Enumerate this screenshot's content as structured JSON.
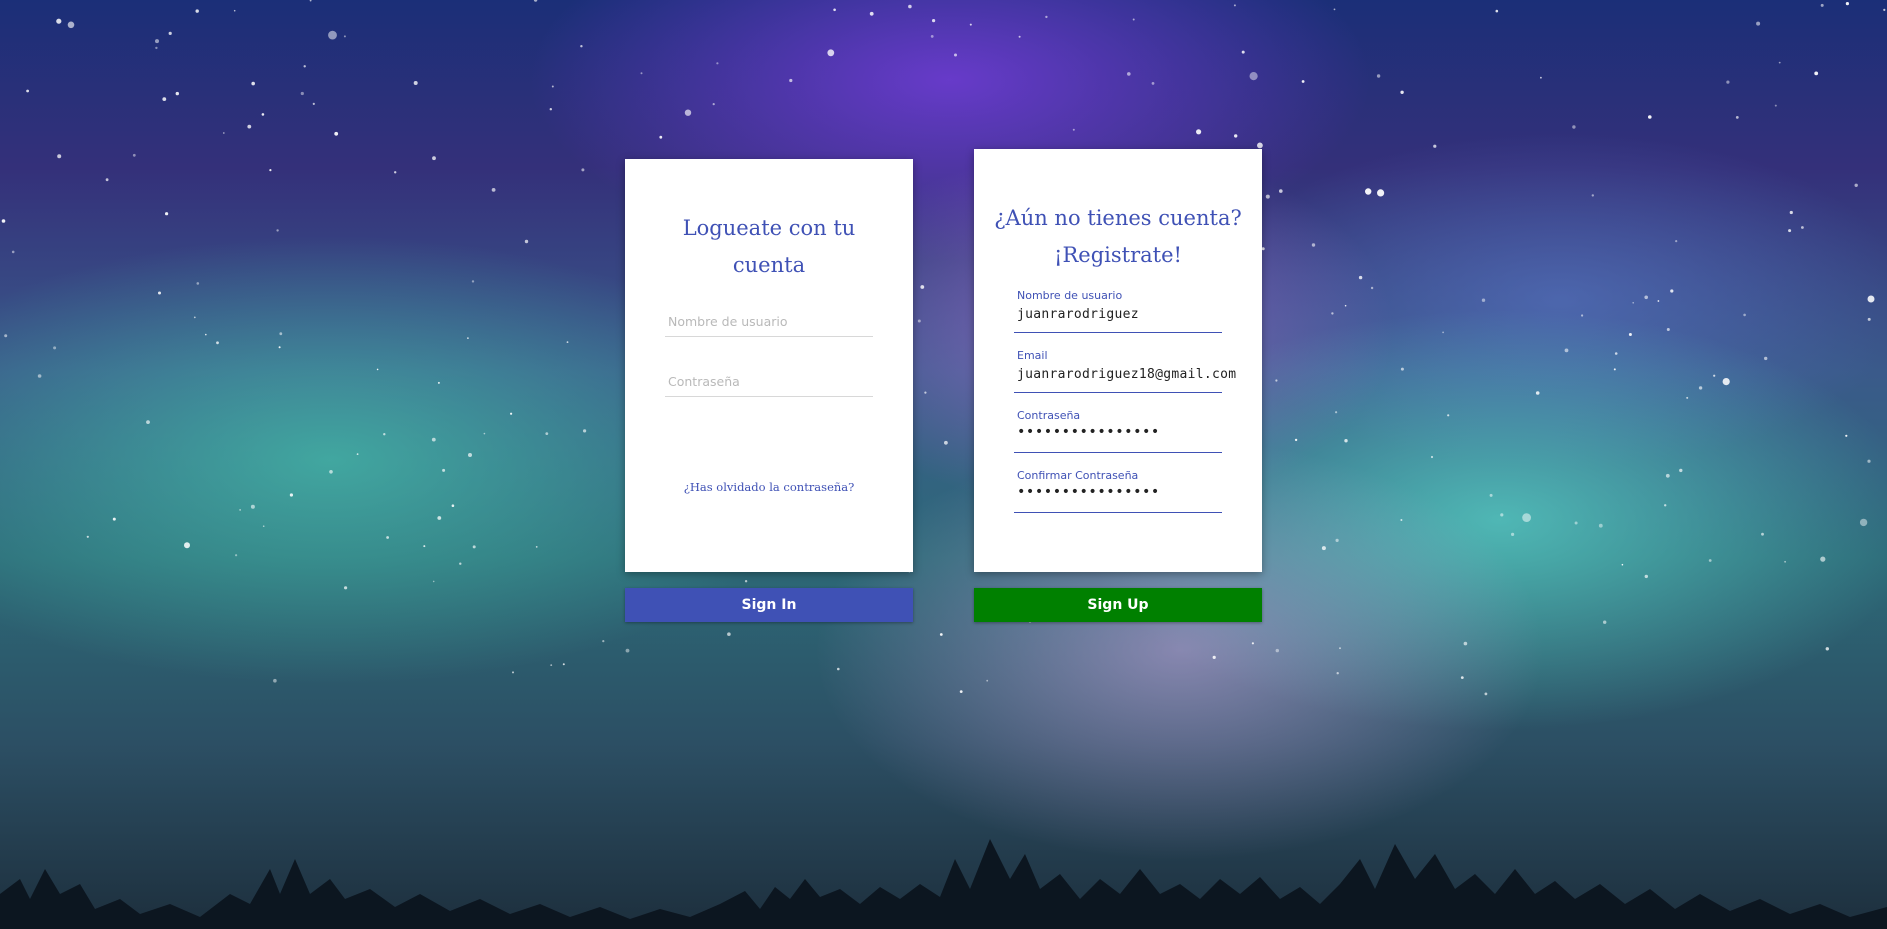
{
  "login": {
    "title": "Logueate con tu cuenta",
    "username_placeholder": "Nombre de usuario",
    "password_placeholder": "Contraseña",
    "forgot_link": "¿Has olvidado la contraseña?",
    "submit_label": "Sign In"
  },
  "register": {
    "title_line1": "¿Aún no tienes cuenta?",
    "title_line2": "¡Registrate!",
    "fields": [
      {
        "label": "Nombre de usuario",
        "value": "juanrarodriguez"
      },
      {
        "label": "Email",
        "value": "juanrarodriguez18@gmail.com"
      },
      {
        "label": "Contraseña",
        "value": "••••••••••••••••"
      },
      {
        "label": "Confirmar Contraseña",
        "value": "••••••••••••••••"
      }
    ],
    "submit_label": "Sign Up"
  },
  "colors": {
    "accent": "#3f51b5",
    "signup": "#008000",
    "card": "#ffffff"
  }
}
